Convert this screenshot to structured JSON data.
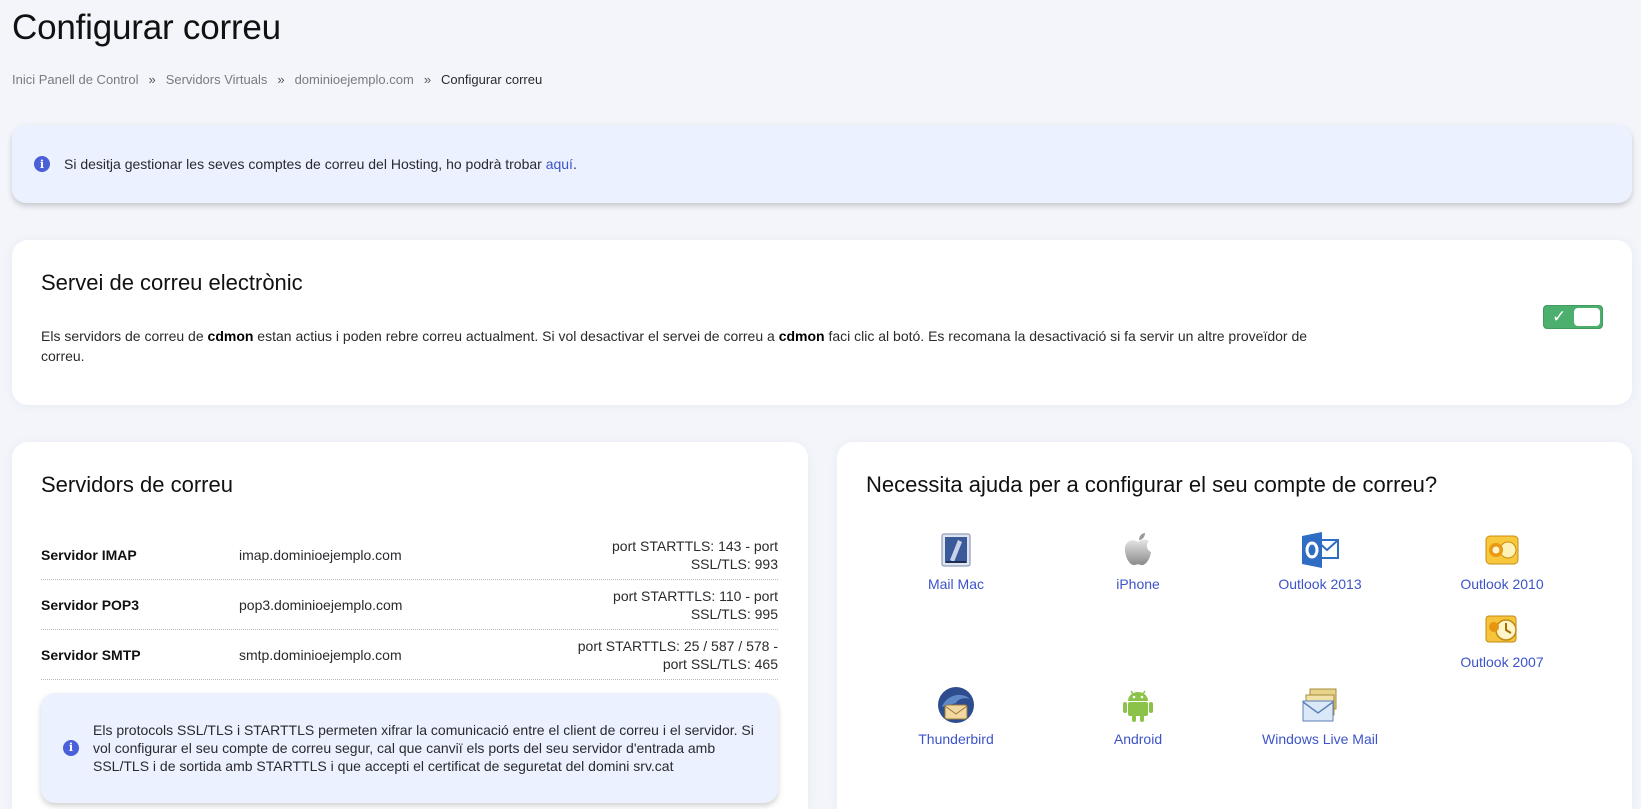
{
  "page": {
    "title": "Configurar correu"
  },
  "breadcrumb": {
    "items": [
      {
        "label": "Inici Panell de Control"
      },
      {
        "label": "Servidors Virtuals"
      },
      {
        "label": "dominioejemplo.com"
      },
      {
        "label": "Configurar correu"
      }
    ],
    "separator": "»"
  },
  "info_banner": {
    "text": "Si desitja gestionar les seves comptes de correu del Hosting, ho podrà trobar ",
    "link_label": "aquí",
    "suffix": "."
  },
  "email_service": {
    "title": "Servei de correu electrònic",
    "desc_part1": "Els servidors de correu de ",
    "brand": "cdmon",
    "desc_part2": " estan actius i poden rebre correu actualment. Si vol desactivar el servei de correu a ",
    "desc_part3": " faci clic al botó. Es recomana la desactivació si fa servir un altre proveïdor de correu.",
    "toggle_on": true,
    "toggle_color": "#4caf6e"
  },
  "servers": {
    "title": "Servidors de correu",
    "rows": [
      {
        "label": "Servidor IMAP",
        "host": "imap.dominioejemplo.com",
        "ports_line1": "port STARTTLS: 143 - port",
        "ports_line2": "SSL/TLS: 993"
      },
      {
        "label": "Servidor POP3",
        "host": "pop3.dominioejemplo.com",
        "ports_line1": "port STARTTLS: 110 - port",
        "ports_line2": "SSL/TLS: 995"
      },
      {
        "label": "Servidor SMTP",
        "host": "smtp.dominioejemplo.com",
        "ports_line1": "port STARTTLS: 25 / 587 / 578 -",
        "ports_line2": "port SSL/TLS: 465"
      }
    ],
    "note": "Els protocols SSL/TLS i STARTTLS permeten xifrar la comunicació entre el client de correu i el servidor. Si vol configurar el seu compte de correu segur, cal que canviï els ports del seu servidor d'entrada amb SSL/TLS i de sortida amb STARTTLS i que accepti el certificat de seguretat del domini srv.cat"
  },
  "help": {
    "title": "Necessita ajuda per a configurar el seu compte de correu?",
    "clients": [
      {
        "label": "Mail Mac",
        "icon": "mail-mac-icon"
      },
      {
        "label": "iPhone",
        "icon": "apple-icon"
      },
      {
        "label": "Outlook 2013",
        "icon": "outlook-2013-icon"
      },
      {
        "label": "Outlook 2010",
        "icon": "outlook-2010-icon"
      },
      {
        "label": "Outlook 2007",
        "icon": "outlook-2007-icon"
      },
      {
        "label": "Thunderbird",
        "icon": "thunderbird-icon"
      },
      {
        "label": "Android",
        "icon": "android-icon"
      },
      {
        "label": "Windows Live Mail",
        "icon": "windows-live-mail-icon"
      }
    ]
  },
  "colors": {
    "accent": "#3d54c8",
    "info_bg": "#ebf1fe",
    "toggle_green": "#4caf6e"
  }
}
